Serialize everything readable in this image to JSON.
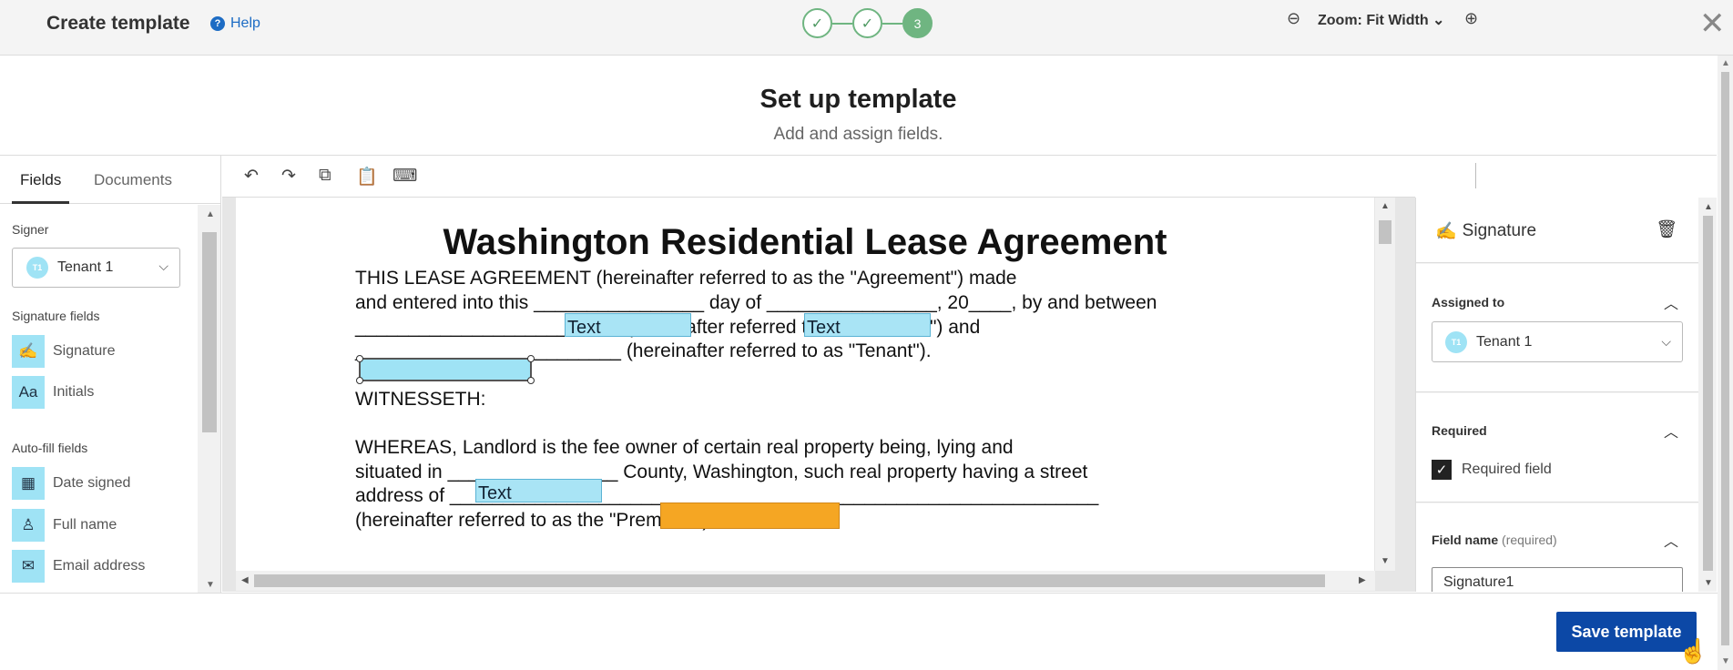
{
  "header": {
    "app_title": "Create template",
    "help_label": "Help",
    "steps": [
      "✓",
      "✓",
      "3"
    ],
    "close_symbol": "✕"
  },
  "page": {
    "title": "Set up template",
    "subtitle": "Add and assign fields."
  },
  "left_panel": {
    "tabs": [
      {
        "label": "Fields",
        "active": true
      },
      {
        "label": "Documents",
        "active": false
      }
    ],
    "signer_label": "Signer",
    "signer_badge": "T1",
    "signer_value": "Tenant 1",
    "signature_fields_label": "Signature fields",
    "signature_fields": [
      {
        "label": "Signature",
        "icon": "signature-icon"
      },
      {
        "label": "Initials",
        "icon": "initials-icon"
      }
    ],
    "autofill_label": "Auto-fill fields",
    "autofill_fields": [
      {
        "label": "Date signed",
        "icon": "calendar-icon"
      },
      {
        "label": "Full name",
        "icon": "person-icon"
      },
      {
        "label": "Email address",
        "icon": "envelope-icon"
      }
    ]
  },
  "toolbar": {
    "tools": [
      "undo-icon",
      "redo-icon",
      "copy-icon",
      "paste-icon",
      "keyboard-icon"
    ],
    "zoom_label": "Zoom: Fit Width"
  },
  "document": {
    "title": "Washington Residential Lease Agreement",
    "lines": [
      "THIS LEASE AGREEMENT (hereinafter referred to as the \"Agreement\") made",
      "and entered into this ________________ day of ________________, 20____, by and between",
      "_________________________ (hereinafter referred to as \"Landlord\") and",
      "_________________________ (hereinafter referred to as \"Tenant\").",
      "WITNESSETH:",
      "WHEREAS, Landlord is the fee owner of certain real property being, lying and",
      "situated in ________________ County, Washington, such real property having a street",
      "address of _____________________________________________________________",
      "(hereinafter referred to as the \"Premises\")."
    ],
    "text_field_label": "Text"
  },
  "right_panel": {
    "title": "Signature",
    "assigned_label": "Assigned to",
    "assigned_badge": "T1",
    "assigned_value": "Tenant 1",
    "required_label": "Required",
    "required_checkbox_label": "Required field",
    "field_name_label": "Field name",
    "field_name_hint": "(required)",
    "field_name_value": "Signature1"
  },
  "footer": {
    "save_label": "Save template"
  },
  "colors": {
    "accent": "#0c48a6",
    "step_green": "#6fb581",
    "field_blue": "#9fe3f5",
    "field_orange": "#f5a623"
  }
}
